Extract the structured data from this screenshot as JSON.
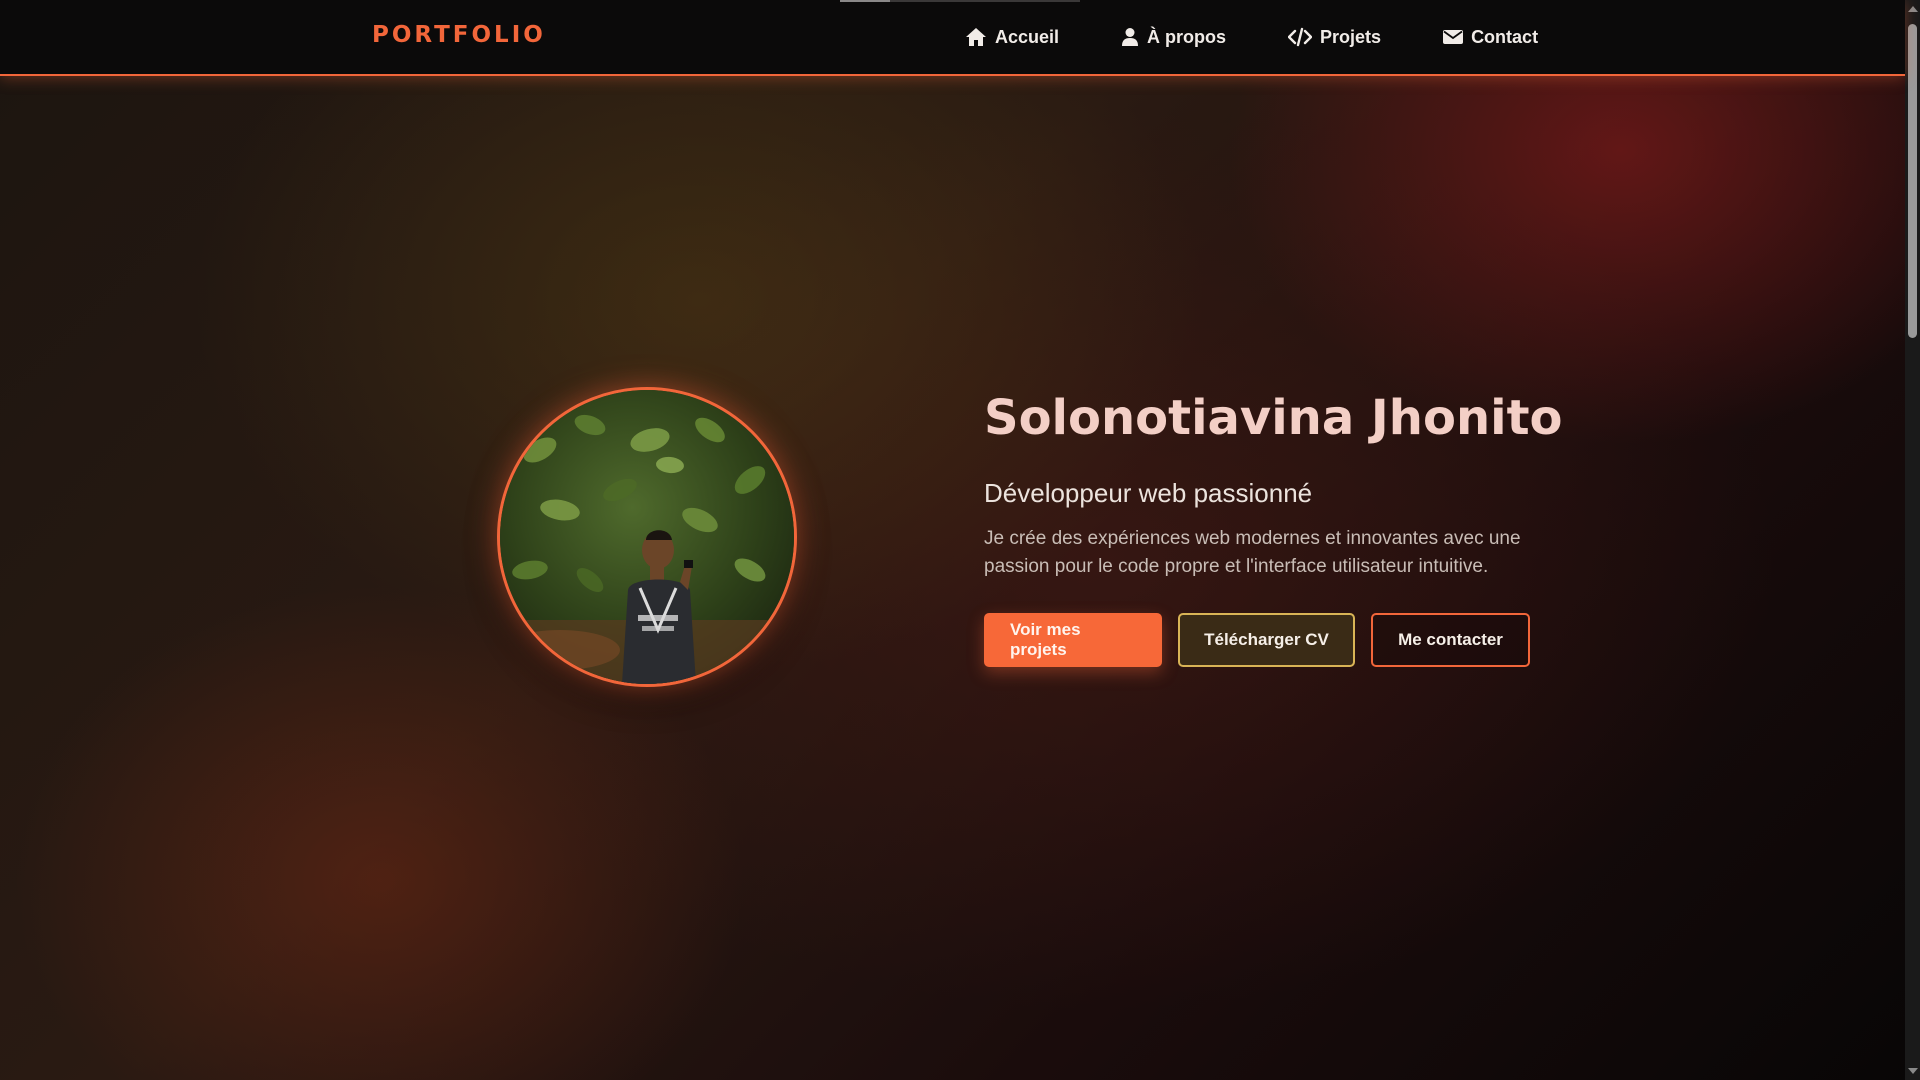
{
  "brand": {
    "logo_text": "PORTFOLIO",
    "accent_color": "#f2663a"
  },
  "nav": {
    "items": [
      {
        "label": "Accueil",
        "icon": "home-icon"
      },
      {
        "label": "À propos",
        "icon": "user-icon"
      },
      {
        "label": "Projets",
        "icon": "code-icon"
      },
      {
        "label": "Contact",
        "icon": "envelope-icon"
      }
    ]
  },
  "hero": {
    "name": "Solonotiavina Jhonito",
    "role": "Développeur web passionné",
    "description": "Je crée des expériences web modernes et innovantes avec une passion pour le code propre et l'interface utilisateur intuitive.",
    "avatar_icon": "profile-photo",
    "buttons": {
      "projects": "Voir mes projets",
      "cv": "Télécharger CV",
      "contact": "Me contacter"
    }
  },
  "colors": {
    "primary_button": "#f76838",
    "gold_border": "#d9b456",
    "name_color": "#f3cfc6"
  }
}
